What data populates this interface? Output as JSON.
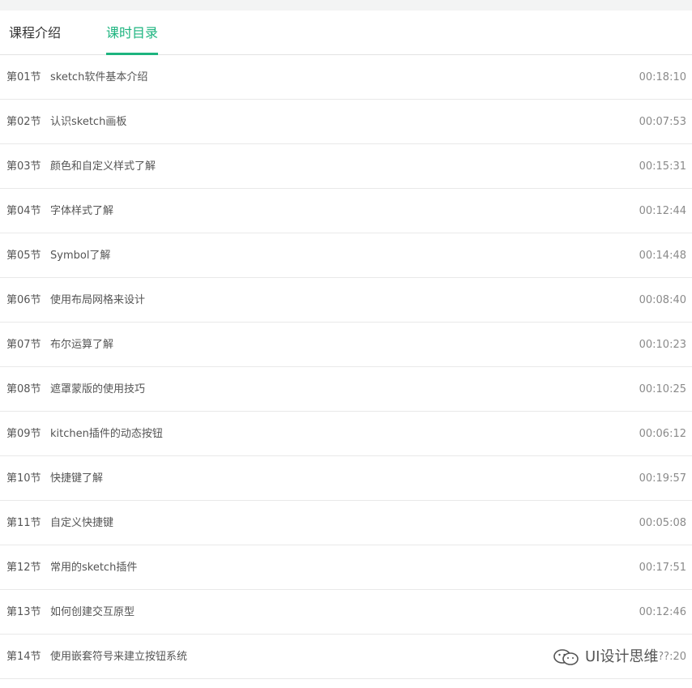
{
  "tabs": [
    {
      "label": "课程介绍",
      "active": false
    },
    {
      "label": "课时目录",
      "active": true
    }
  ],
  "accent_color": "#1db47f",
  "lessons": [
    {
      "num": "第01节",
      "title": "sketch软件基本介绍",
      "duration": "00:18:10"
    },
    {
      "num": "第02节",
      "title": "认识sketch画板",
      "duration": "00:07:53"
    },
    {
      "num": "第03节",
      "title": "颜色和自定义样式了解",
      "duration": "00:15:31"
    },
    {
      "num": "第04节",
      "title": "字体样式了解",
      "duration": "00:12:44"
    },
    {
      "num": "第05节",
      "title": "Symbol了解",
      "duration": "00:14:48"
    },
    {
      "num": "第06节",
      "title": "使用布局网格来设计",
      "duration": "00:08:40"
    },
    {
      "num": "第07节",
      "title": "布尔运算了解",
      "duration": "00:10:23"
    },
    {
      "num": "第08节",
      "title": "遮罩蒙版的使用技巧",
      "duration": "00:10:25"
    },
    {
      "num": "第09节",
      "title": "kitchen插件的动态按钮",
      "duration": "00:06:12"
    },
    {
      "num": "第10节",
      "title": "快捷键了解",
      "duration": "00:19:57"
    },
    {
      "num": "第11节",
      "title": "自定义快捷键",
      "duration": "00:05:08"
    },
    {
      "num": "第12节",
      "title": "常用的sketch插件",
      "duration": "00:17:51"
    },
    {
      "num": "第13节",
      "title": "如何创建交互原型",
      "duration": "00:12:46"
    },
    {
      "num": "第14节",
      "title": "使用嵌套符号来建立按钮系统",
      "duration": "00:??:20"
    }
  ],
  "watermark": {
    "text": "UI设计思维",
    "icon": "wechat-icon"
  }
}
